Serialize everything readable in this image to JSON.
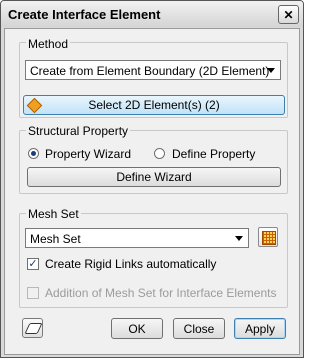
{
  "window": {
    "title": "Create Interface Element"
  },
  "method": {
    "group_label": "Method",
    "selected": "Create from Element Boundary (2D Element)",
    "select_button": "Select 2D Element(s) (2)"
  },
  "structural_property": {
    "group_label": "Structural Property",
    "radio_property_wizard": "Property Wizard",
    "radio_define_property": "Define Property",
    "property_wizard_selected": true,
    "define_wizard_button": "Define Wizard"
  },
  "mesh_set": {
    "group_label": "Mesh Set",
    "selected": "Mesh Set",
    "create_rigid_links": "Create Rigid Links automatically",
    "create_rigid_links_checked": true,
    "addition_of_mesh_set": "Addition of Mesh Set for Interface Elements",
    "addition_enabled": false
  },
  "footer": {
    "ok": "OK",
    "close": "Close",
    "apply": "Apply"
  },
  "icons": {
    "close": "close-icon",
    "select": "diamond-select-icon",
    "mesh_grid": "grid-icon",
    "eraser": "eraser-icon"
  }
}
